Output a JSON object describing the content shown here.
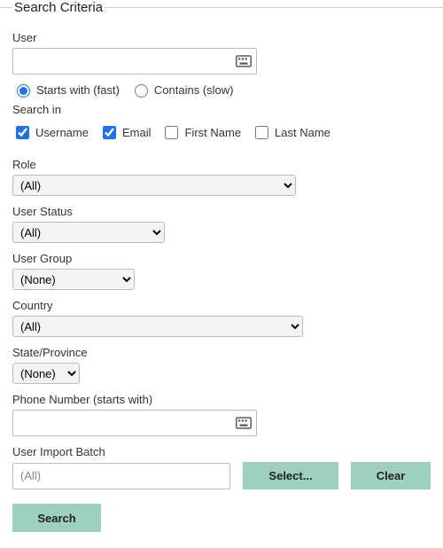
{
  "legend": "Search Criteria",
  "user": {
    "label": "User",
    "value": "",
    "match": {
      "starts": "Starts with (fast)",
      "contains": "Contains (slow)",
      "selected": "starts"
    }
  },
  "search_in": {
    "label": "Search in",
    "options": {
      "username": {
        "label": "Username",
        "checked": true
      },
      "email": {
        "label": "Email",
        "checked": true
      },
      "first_name": {
        "label": "First Name",
        "checked": false
      },
      "last_name": {
        "label": "Last Name",
        "checked": false
      }
    }
  },
  "role": {
    "label": "Role",
    "value": "(All)"
  },
  "status": {
    "label": "User Status",
    "value": "(All)"
  },
  "group": {
    "label": "User Group",
    "value": "(None)"
  },
  "country": {
    "label": "Country",
    "value": "(All)"
  },
  "state": {
    "label": "State/Province",
    "value": "(None)"
  },
  "phone": {
    "label": "Phone Number (starts with)",
    "value": ""
  },
  "batch": {
    "label": "User Import Batch",
    "value": "(All)"
  },
  "buttons": {
    "select": "Select...",
    "clear": "Clear",
    "search": "Search"
  }
}
